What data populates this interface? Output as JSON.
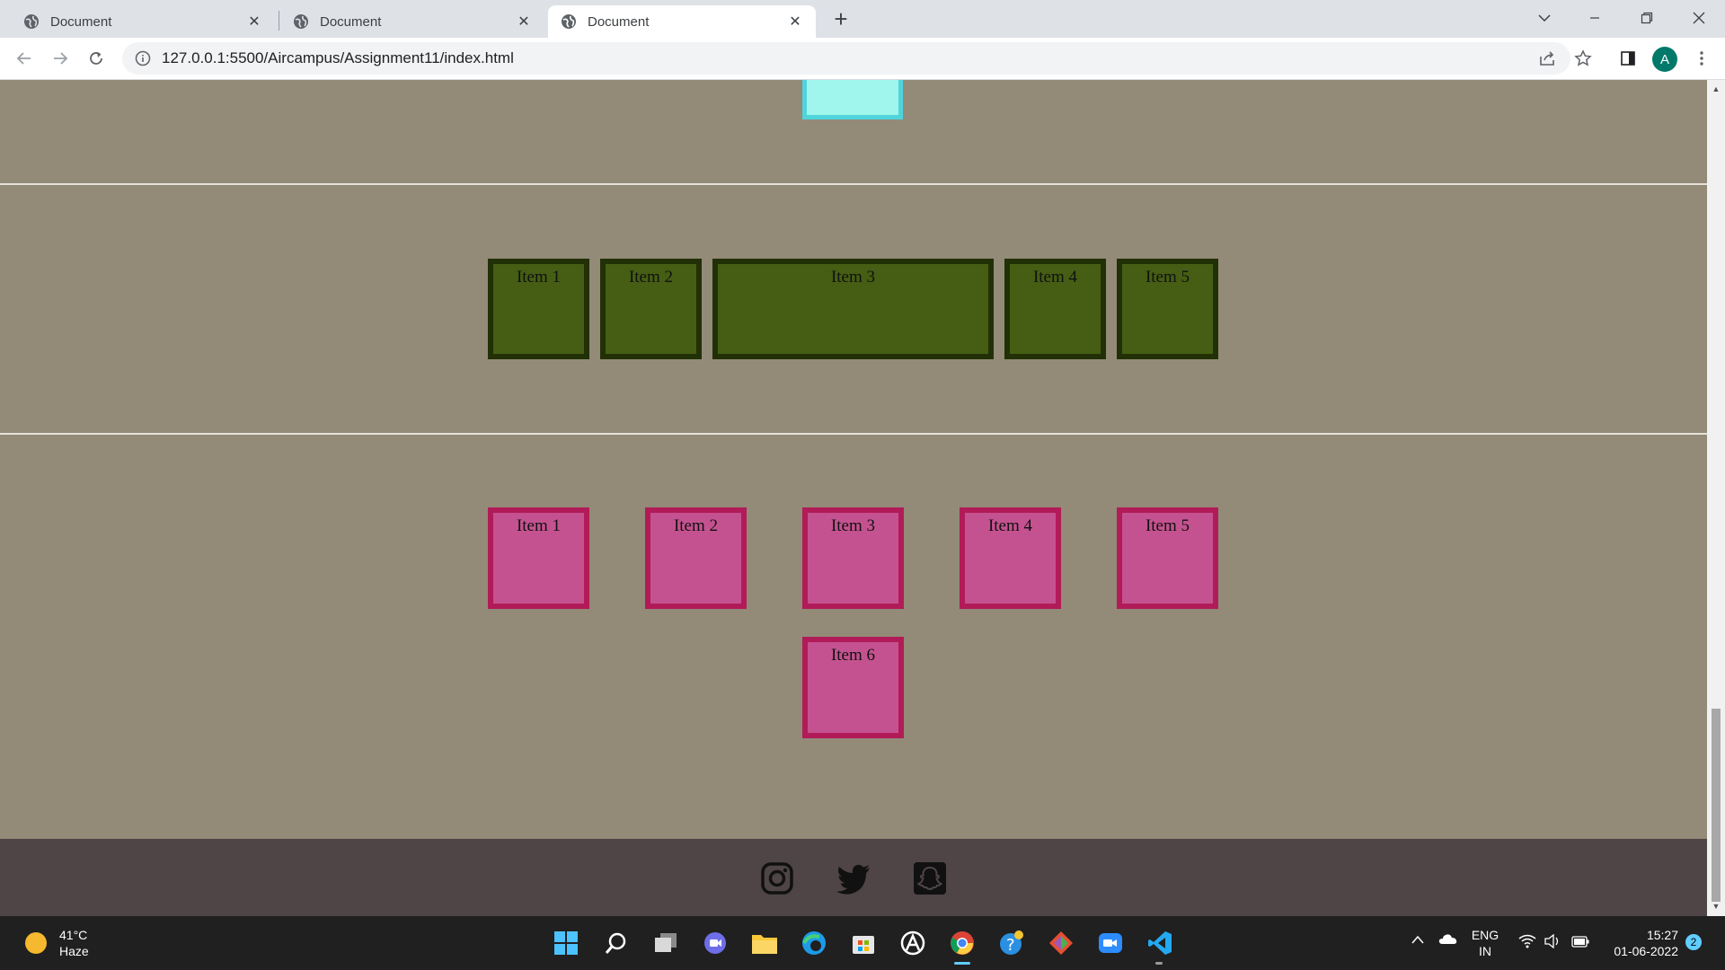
{
  "browser": {
    "tabs": [
      {
        "title": "Document",
        "active": false
      },
      {
        "title": "Document",
        "active": false
      },
      {
        "title": "Document",
        "active": true
      }
    ],
    "url": "127.0.0.1:5500/Aircampus/Assignment11/index.html",
    "profile_initial": "A"
  },
  "page": {
    "background_color": "#938a78",
    "green_row": {
      "items": [
        "Item 1",
        "Item 2",
        "Item 3",
        "Item 4",
        "Item 5"
      ],
      "fill_color": "#455e13",
      "border_color": "#223007"
    },
    "pink_grid": {
      "items": [
        "Item 1",
        "Item 2",
        "Item 3",
        "Item 4",
        "Item 5",
        "Item 6"
      ],
      "fill_color": "#c55290",
      "border_color": "#b11b58"
    },
    "footer": {
      "icons": [
        "instagram-icon",
        "twitter-icon",
        "snapchat-icon"
      ],
      "background_color": "#4f4546"
    }
  },
  "taskbar": {
    "weather": {
      "temp": "41°C",
      "condition": "Haze"
    },
    "language": {
      "lang": "ENG",
      "region": "IN"
    },
    "clock": {
      "time": "15:27",
      "date": "01-06-2022"
    },
    "notification_count": "2"
  }
}
